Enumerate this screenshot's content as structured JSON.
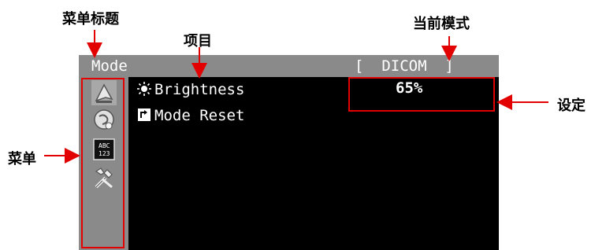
{
  "annotations": {
    "menu_title": "菜单标题",
    "item": "项目",
    "current_mode": "当前模式",
    "setting": "设定",
    "menu": "菜单"
  },
  "osd": {
    "title": "Mode",
    "current_mode": "[  DICOM  ]",
    "items": [
      {
        "label": "Brightness",
        "icon": "brightness-icon"
      },
      {
        "label": "Mode Reset",
        "icon": "reset-icon"
      }
    ],
    "setting_value": "65%",
    "menus": [
      "mode-menu-icon",
      "color-menu-icon",
      "info-menu-icon",
      "tools-menu-icon"
    ]
  },
  "colors": {
    "header": "#8a8a8a",
    "screen": "#000000",
    "highlight": "#e30000"
  }
}
